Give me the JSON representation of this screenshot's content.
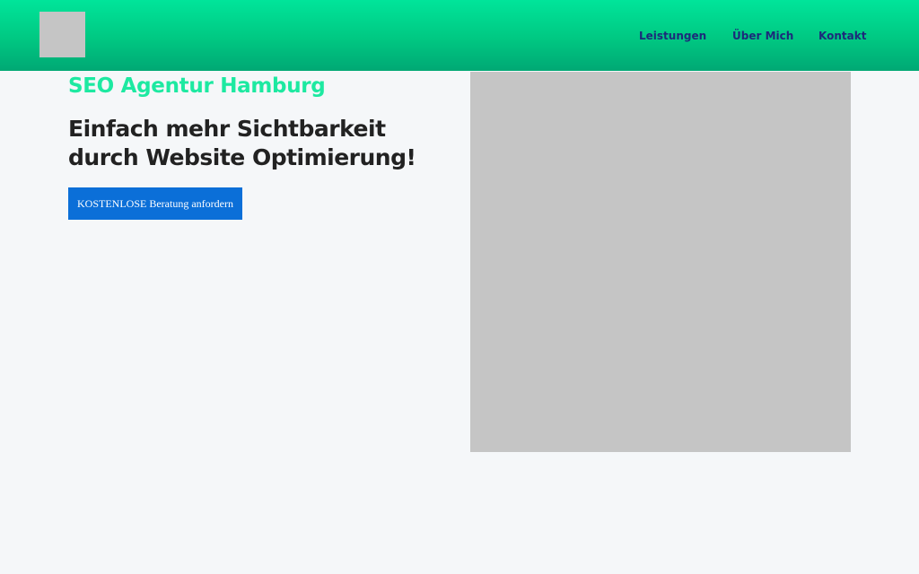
{
  "header": {
    "nav": [
      {
        "label": "Leistungen"
      },
      {
        "label": "Über Mich"
      },
      {
        "label": "Kontakt"
      }
    ]
  },
  "hero": {
    "subtitle": "SEO Agentur Hamburg",
    "title": "Einfach mehr Sichtbarkeit durch Website Optimierung!",
    "cta_label": "KOSTENLOSE Beratung anfordern"
  },
  "colors": {
    "header_gradient_top": "#00e59a",
    "header_gradient_bottom": "#00a874",
    "nav_text": "#1c2a7a",
    "subtitle": "#1de9a1",
    "title": "#222222",
    "cta_background": "#0b6fd8",
    "placeholder": "#c5c5c5",
    "page_background": "#f5f7f9"
  }
}
